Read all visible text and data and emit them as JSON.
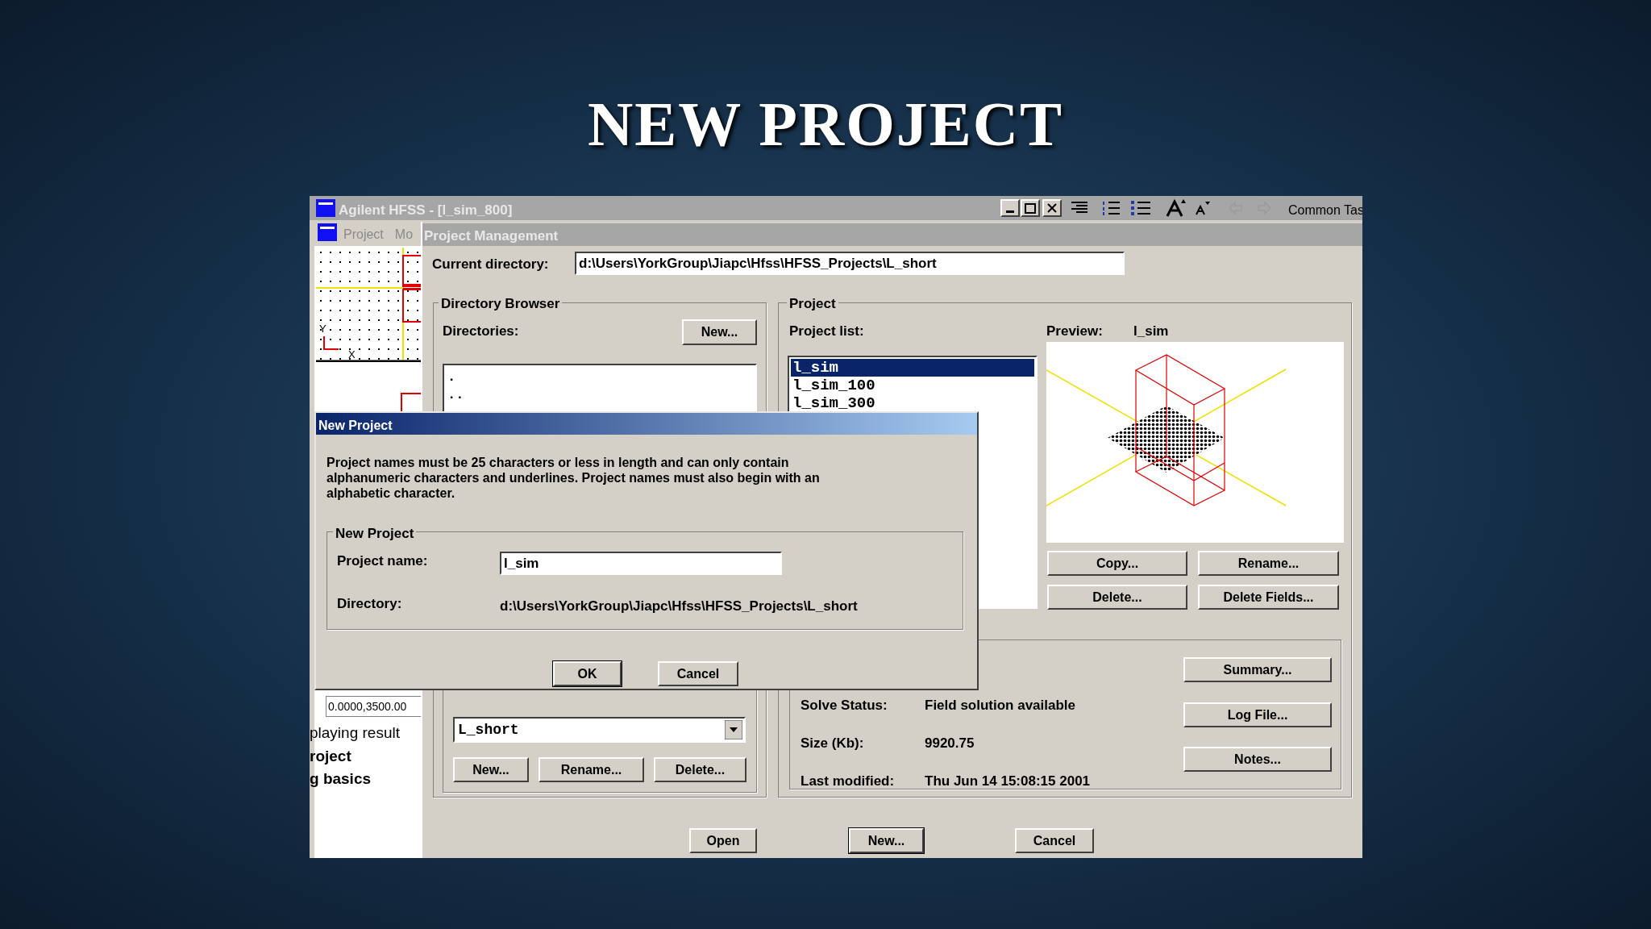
{
  "slide_title": "NEW PROJECT",
  "app_window": {
    "title": "Agilent HFSS - [l_sim_800]",
    "menu": [
      "Project",
      "Mo"
    ],
    "toolbar_label": "Common Tas",
    "axis_labels": [
      "Y",
      "X"
    ],
    "status_field": "0.0000,3500.00",
    "side_list": [
      "playing result",
      "roject",
      "g basics"
    ]
  },
  "project_management": {
    "title": "Project Management",
    "current_directory_label": "Current directory:",
    "current_directory": "d:\\Users\\YorkGroup\\Jiapc\\Hfss\\HFSS_Projects\\L_short",
    "directory_browser": {
      "title": "Directory Browser",
      "label": "Directories:",
      "new_button": "New...",
      "directories": [
        ".",
        ".."
      ],
      "drive": "L_short",
      "buttons": [
        "New...",
        "Rename...",
        "Delete..."
      ]
    },
    "project": {
      "title": "Project",
      "list_label": "Project list:",
      "projects": [
        {
          "name": "l_sim",
          "selected": true
        },
        {
          "name": "l_sim_100",
          "selected": false
        },
        {
          "name": "l_sim_300",
          "selected": false
        }
      ],
      "preview_label": "Preview:",
      "preview_name": "l_sim",
      "buttons": [
        "Copy...",
        "Rename...",
        "Delete...",
        "Delete Fields..."
      ],
      "info": [
        {
          "label": "Solve Status:",
          "value": "Field solution available"
        },
        {
          "label": "Size (Kb):",
          "value": "9920.75"
        },
        {
          "label": "Last modified:",
          "value": "Thu Jun 14 15:08:15 2001"
        }
      ],
      "info_buttons": [
        "Summary...",
        "Log File...",
        "Notes..."
      ]
    },
    "buttons": [
      "Open",
      "New...",
      "Cancel"
    ]
  },
  "new_project_dialog": {
    "title": "New Project",
    "message": "Project names must be 25 characters or less in length and can only contain alphanumeric characters and underlines. Project names must also begin with an alphabetic character.",
    "group_title": "New Project",
    "name_label": "Project name:",
    "name_value": "l_sim",
    "directory_label": "Directory:",
    "directory": "d:\\Users\\YorkGroup\\Jiapc\\Hfss\\HFSS_Projects\\L_short",
    "buttons": [
      "OK",
      "Cancel"
    ]
  }
}
